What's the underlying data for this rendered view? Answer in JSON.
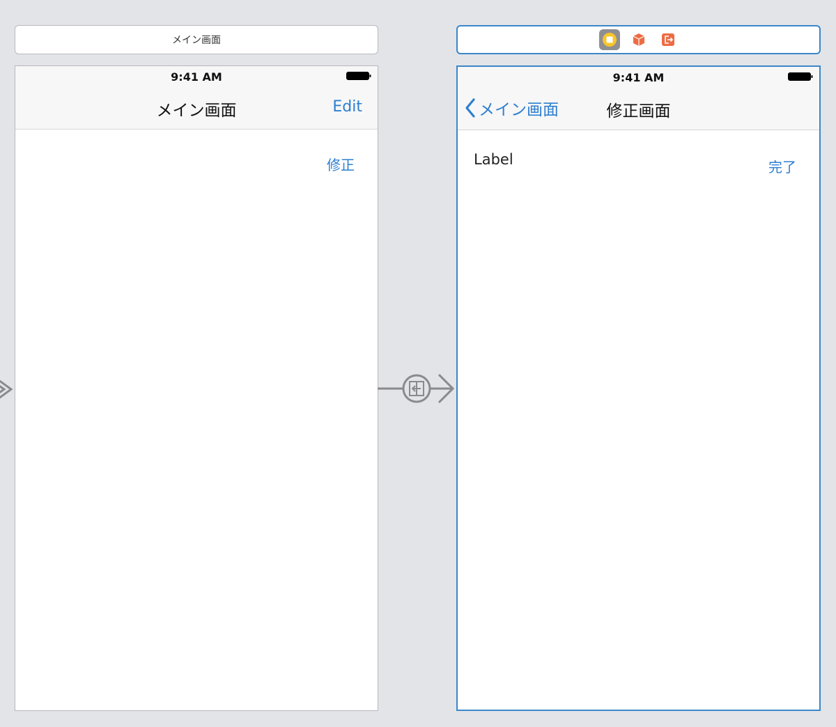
{
  "scenes": {
    "main": {
      "scene_title": "メイン画面",
      "status_time": "9:41 AM",
      "nav_title": "メイン画面",
      "nav_right": "Edit",
      "content_button": "修正"
    },
    "edit": {
      "status_time": "9:41 AM",
      "back_label": "メイン画面",
      "nav_title": "修正画面",
      "label_text": "Label",
      "content_button": "完了",
      "dock_icons": [
        "view-controller-icon",
        "first-responder-icon",
        "exit-icon"
      ]
    }
  },
  "colors": {
    "tint": "#2d7fd0",
    "selection": "#3a87c9",
    "canvas": "#e3e4e8"
  }
}
